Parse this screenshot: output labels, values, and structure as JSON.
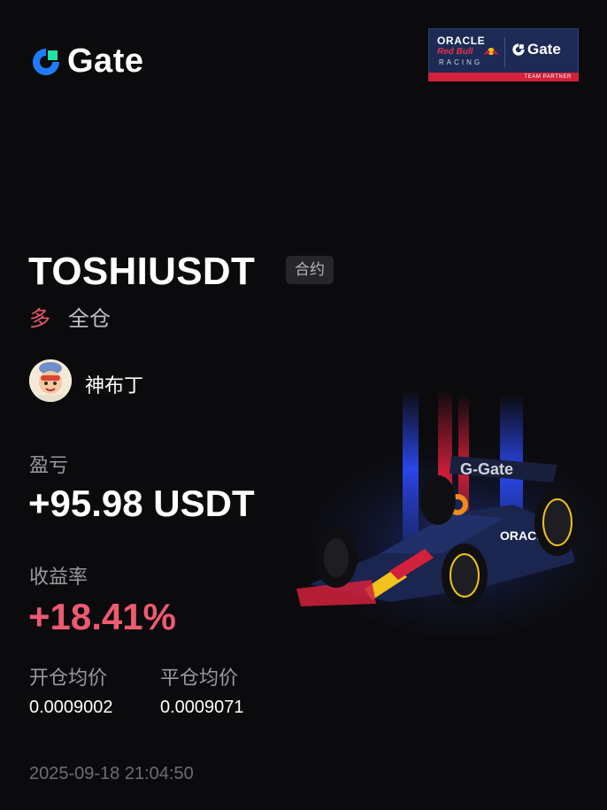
{
  "brand": {
    "name": "Gate",
    "logo_color": "#1f7bff",
    "logo_accent": "#1fe2a4"
  },
  "partner": {
    "oracle": "ORACLE",
    "redbull": "Red Bull",
    "racing": "RACING",
    "gate": "Gate",
    "team_partner": "TEAM PARTNER"
  },
  "position": {
    "symbol": "TOSHIUSDT",
    "contract_badge": "合约",
    "side": "多",
    "margin_mode": "全仓"
  },
  "user": {
    "name": "神布丁"
  },
  "pnl": {
    "label": "盈亏",
    "value": "+95.98 USDT"
  },
  "roi": {
    "label": "收益率",
    "value": "+18.41%"
  },
  "prices": {
    "open_label": "开仓均价",
    "open_value": "0.0009002",
    "close_label": "平仓均价",
    "close_value": "0.0009071"
  },
  "timestamp": "2025-09-18 21:04:50",
  "colors": {
    "background": "#0b0b0d",
    "long": "#e65a6c",
    "roi": "#ee5a70",
    "muted": "#9a9a9f"
  }
}
